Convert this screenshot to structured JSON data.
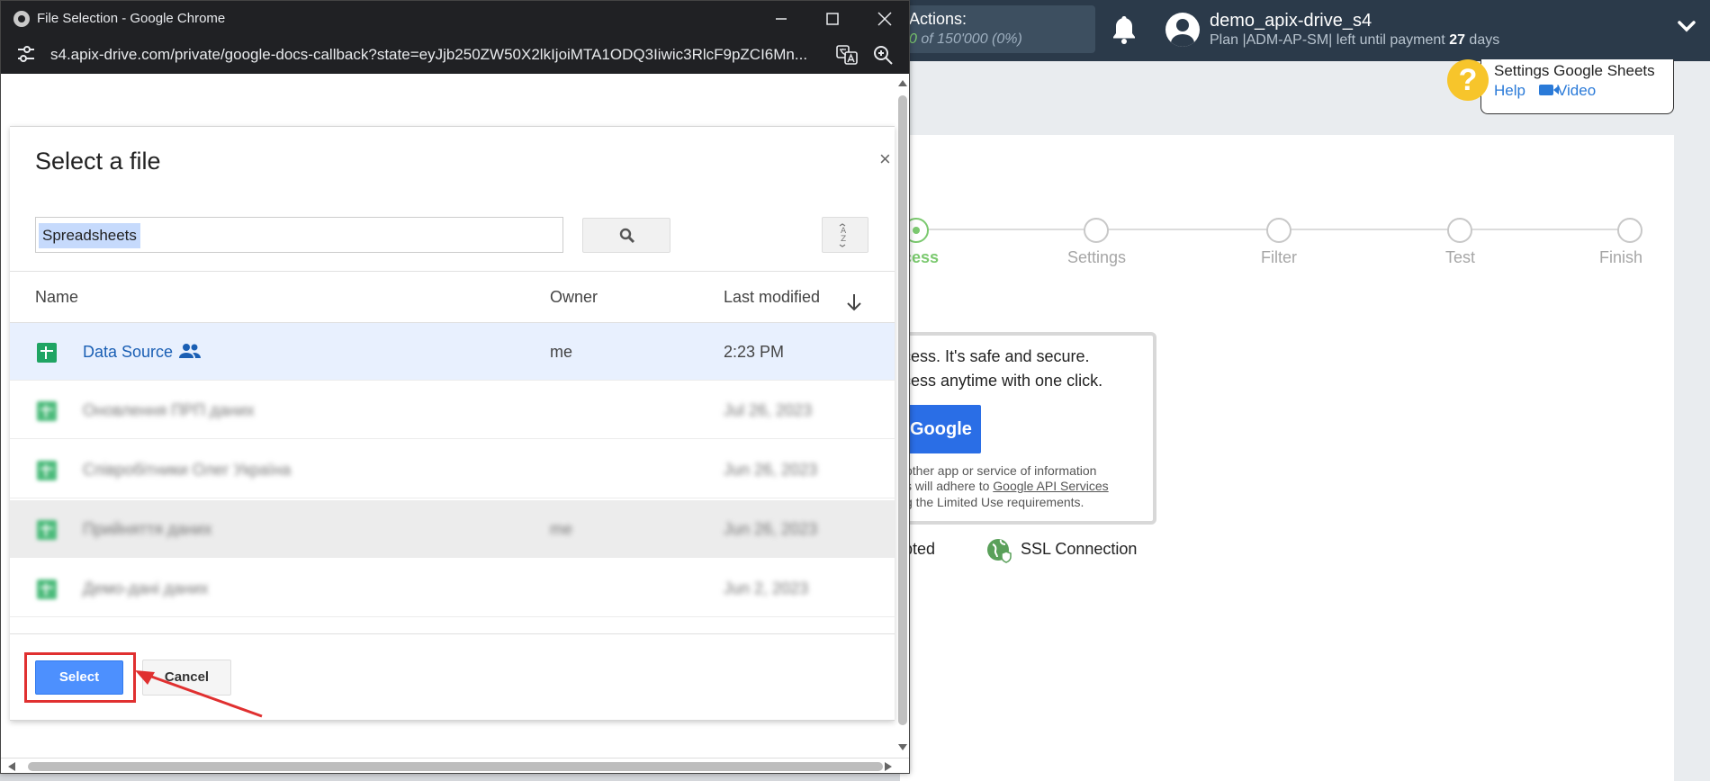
{
  "app": {
    "actions_label": "Actions:",
    "actions_value": "0",
    "actions_rest": " of 150'000 (0%)",
    "username": "demo_apix-drive_s4",
    "plan_prefix": "Plan |ADM-AP-SM| left until payment ",
    "plan_days": "27",
    "plan_suffix": " days",
    "help_title": "Settings Google Sheets",
    "help_link": "Help",
    "video_link": "Video",
    "steps": [
      {
        "label": "cess",
        "active": true
      },
      {
        "label": "Settings",
        "active": false
      },
      {
        "label": "Filter",
        "active": false
      },
      {
        "label": "Test",
        "active": false
      },
      {
        "label": "Finish",
        "active": false
      }
    ],
    "access_line1": "cess. It's safe and secure.",
    "access_line2": "cess anytime with one click.",
    "google_button": "Google",
    "small_line1": "other app or service of information",
    "small_line2_prefix": "s will adhere to ",
    "small_line2_link": "Google API Services",
    "small_line3": "g the Limited Use requirements.",
    "encrypted_label": "pted",
    "ssl_label": "SSL Connection"
  },
  "window": {
    "title": "File Selection - Google Chrome",
    "url": "s4.apix-drive.com/private/google-docs-callback?state=eyJjb250ZW50X2lkIjoiMTA1ODQ3Iiwic3RlcF9pZCI6Mn..."
  },
  "picker": {
    "title": "Select a file",
    "close": "×",
    "search_value": "Spreadsheets",
    "columns": {
      "name": "Name",
      "owner": "Owner",
      "modified": "Last modified"
    },
    "rows": [
      {
        "name": "Data Source",
        "owner": "me",
        "modified": "2:23 PM"
      },
      {
        "name": "Оновлення ПРП даних",
        "owner": "",
        "modified": "Jul 26, 2023"
      },
      {
        "name": "Співробітники Олег Україна",
        "owner": "",
        "modified": "Jun 26, 2023"
      },
      {
        "name": "Прийняття даних",
        "owner": "me",
        "modified": "Jun 26, 2023"
      },
      {
        "name": "Демо-дані даних",
        "owner": "",
        "modified": "Jun 2, 2023"
      }
    ],
    "select_label": "Select",
    "cancel_label": "Cancel"
  },
  "colors": {
    "accent_blue": "#4d90fe",
    "highlight_red": "#e03030",
    "success_green": "#7bc96f"
  }
}
